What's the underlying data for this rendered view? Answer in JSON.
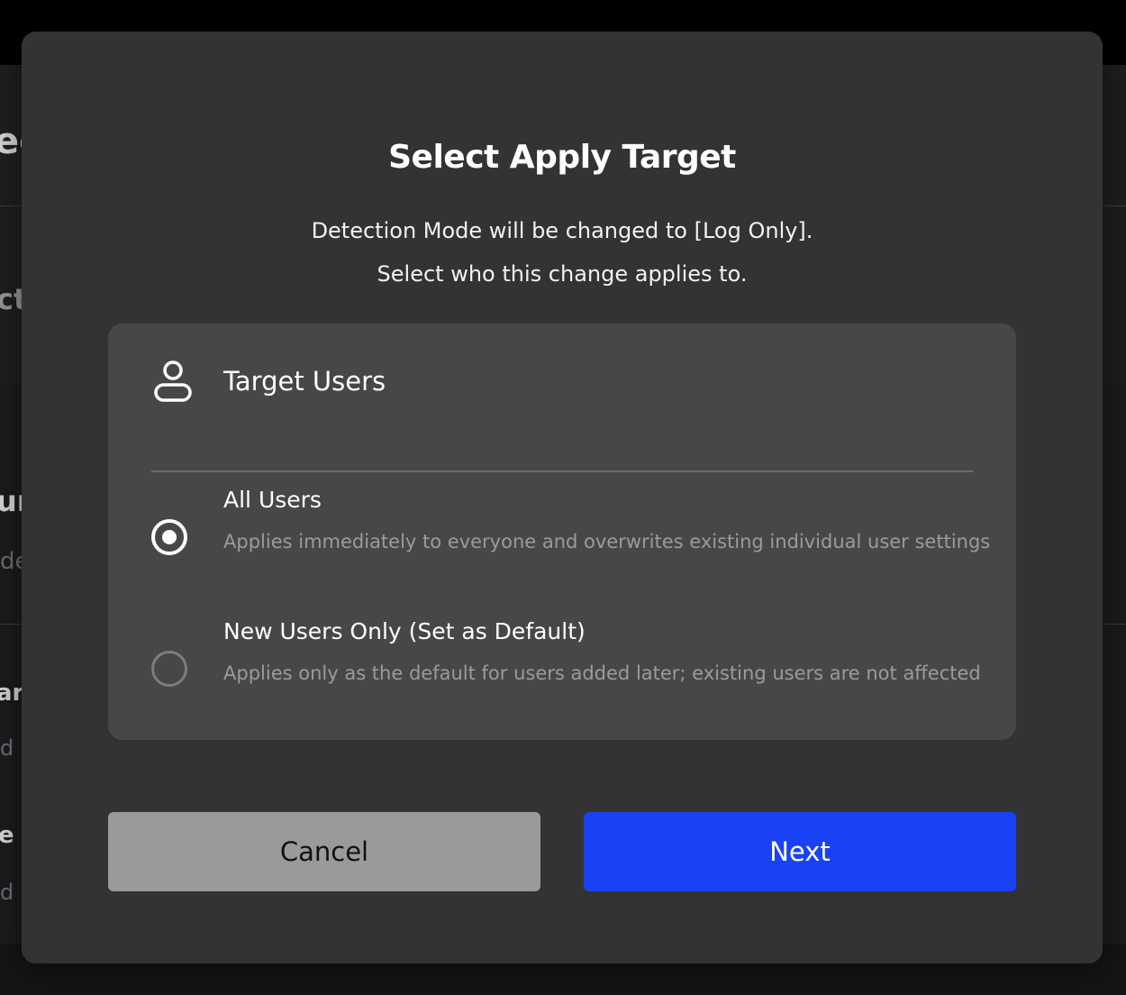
{
  "background": {
    "fragments": [
      "ec",
      "ct",
      "ur",
      "de",
      "ar",
      "d w",
      "e t",
      "d w"
    ]
  },
  "dialog": {
    "title": "Select Apply Target",
    "description_line1": "Detection Mode will be changed to [Log Only].",
    "description_line2": "Select who this change applies to.",
    "target_section": {
      "icon": "user-icon",
      "heading": "Target Users",
      "options": [
        {
          "label": "All Users",
          "description": "Applies immediately to everyone and overwrites existing individual user settings",
          "selected": true
        },
        {
          "label": "New Users Only (Set as Default)",
          "description": "Applies only as the default for users added later; existing users are not affected",
          "selected": false
        }
      ]
    },
    "buttons": {
      "cancel_label": "Cancel",
      "next_label": "Next"
    },
    "colors": {
      "primary": "#1a42f5",
      "secondary": "#9a9a9a",
      "surface": "#333334",
      "card": "#474748"
    }
  }
}
